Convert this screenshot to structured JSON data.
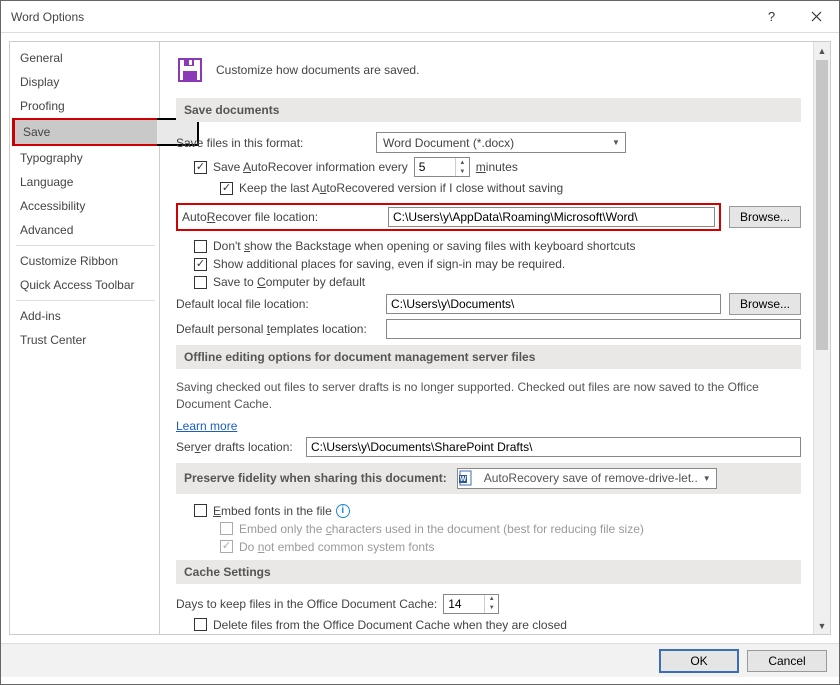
{
  "window": {
    "title": "Word Options"
  },
  "sidebar": {
    "items": [
      {
        "label": "General"
      },
      {
        "label": "Display"
      },
      {
        "label": "Proofing"
      },
      {
        "label": "Save",
        "selected": true
      },
      {
        "label": "Typography"
      },
      {
        "label": "Language"
      },
      {
        "label": "Accessibility"
      },
      {
        "label": "Advanced"
      },
      {
        "label": "Customize Ribbon"
      },
      {
        "label": "Quick Access Toolbar"
      },
      {
        "label": "Add-ins"
      },
      {
        "label": "Trust Center"
      }
    ]
  },
  "header": {
    "subtitle": "Customize how documents are saved."
  },
  "save_docs": {
    "heading": "Save documents",
    "format_label": "Save files in this format:",
    "format_value": "Word Document (*.docx)",
    "autorecover_label_pre": "Save ",
    "autorecover_label_u": "A",
    "autorecover_label_post": "utoRecover information every",
    "autorecover_minutes": "5",
    "minutes_u": "m",
    "minutes_post": "inutes",
    "keep_last_pre": "Keep the last A",
    "keep_last_u": "u",
    "keep_last_post": "toRecovered version if I close without saving",
    "ar_loc_label_pre": "Auto",
    "ar_loc_label_u": "R",
    "ar_loc_label_post": "ecover file location:",
    "ar_loc_value": "C:\\Users\\y\\AppData\\Roaming\\Microsoft\\Word\\",
    "browse_pre": "",
    "browse_u": "B",
    "browse_post": "rowse...",
    "dont_show_pre": "Don't ",
    "dont_show_u": "s",
    "dont_show_post": "how the Backstage when opening or saving files with keyboard shortcuts",
    "show_additional": "Show additional places for saving, even if sign-in may be required.",
    "save_computer_pre": "Save to ",
    "save_computer_u": "C",
    "save_computer_post": "omputer by default",
    "default_local_pre": "Default local file location:",
    "default_local_value": "C:\\Users\\y\\Documents\\",
    "browse2_u": "B",
    "browse2_post": "rowse...",
    "default_tmpl_pre": "Default personal ",
    "default_tmpl_u": "t",
    "default_tmpl_post": "emplates location:",
    "default_tmpl_value": ""
  },
  "offline": {
    "heading": "Offline editing options for document management server files",
    "desc": "Saving checked out files to server drafts is no longer supported. Checked out files are now saved to the Office Document Cache.",
    "learn_more": "Learn more",
    "drafts_label_pre": "Ser",
    "drafts_label_u": "v",
    "drafts_label_post": "er drafts location:",
    "drafts_value": "C:\\Users\\y\\Documents\\SharePoint Drafts\\"
  },
  "fidelity": {
    "heading": "Preserve fidelity when sharing this document:",
    "doc_name": "AutoRecovery save of remove-drive-let...",
    "embed_pre": "",
    "embed_u": "E",
    "embed_post": "mbed fonts in the file",
    "embed_chars_pre": "Embed only the ",
    "embed_chars_u": "c",
    "embed_chars_post": "haracters used in the document (best for reducing file size)",
    "no_common_pre": "Do ",
    "no_common_u": "n",
    "no_common_post": "ot embed common system fonts"
  },
  "cache": {
    "heading": "Cache Settings",
    "days_label": "Days to keep files in the Office Document Cache:",
    "days_value": "14",
    "delete_label": "Delete files from the Office Document Cache when they are closed"
  },
  "footer": {
    "ok": "OK",
    "cancel": "Cancel"
  }
}
